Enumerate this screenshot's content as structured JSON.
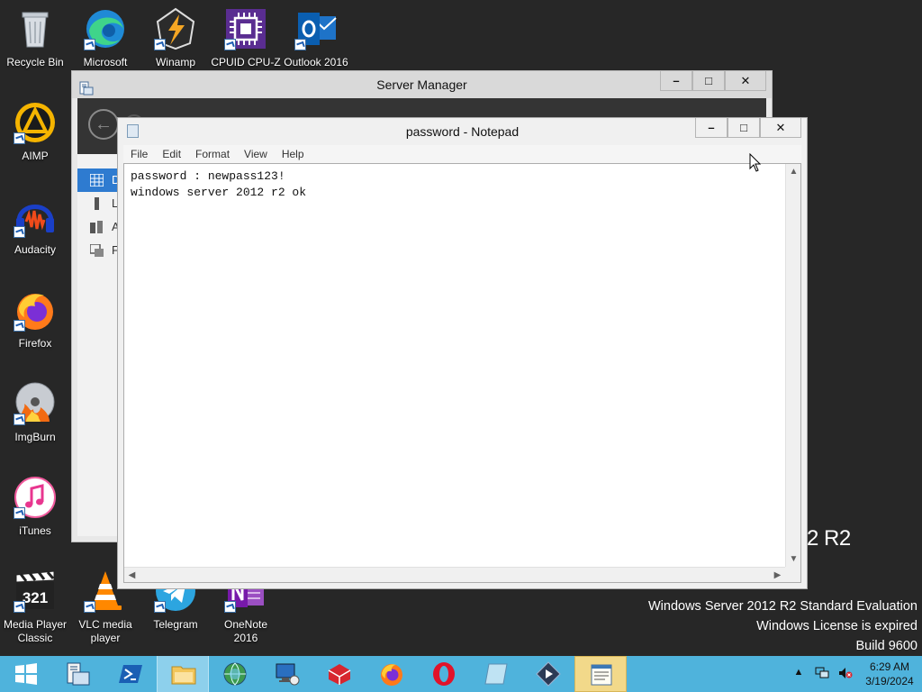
{
  "desktop": {
    "icons": [
      {
        "label": "Recycle Bin",
        "icon": "recycle-bin-icon"
      },
      {
        "label": "Microsoft Edge",
        "icon": "edge-icon"
      },
      {
        "label": "Winamp",
        "icon": "winamp-icon"
      },
      {
        "label": "CPUID CPU-Z",
        "icon": "cpuz-icon"
      },
      {
        "label": "Outlook 2016",
        "icon": "outlook-icon"
      },
      {
        "label": "AIMP",
        "icon": "aimp-icon"
      },
      {
        "label": "Audacity",
        "icon": "audacity-icon"
      },
      {
        "label": "Firefox",
        "icon": "firefox-icon"
      },
      {
        "label": "ImgBurn",
        "icon": "imgburn-icon"
      },
      {
        "label": "iTunes",
        "icon": "itunes-icon"
      },
      {
        "label": "Media Player Classic",
        "icon": "mpc-icon"
      },
      {
        "label": "VLC media player",
        "icon": "vlc-icon"
      },
      {
        "label": "Telegram",
        "icon": "telegram-icon"
      },
      {
        "label": "OneNote 2016",
        "icon": "onenote-icon"
      }
    ]
  },
  "watermark": {
    "edition_fragment": "2 R2",
    "line1": "Windows Server 2012 R2 Standard Evaluation",
    "line2": "Windows License is expired",
    "line3": "Build 9600"
  },
  "server_manager": {
    "title": "Server Manager",
    "nav_fragments": [
      "D",
      "L",
      "A",
      "F"
    ]
  },
  "notepad": {
    "title": "password - Notepad",
    "menu": [
      "File",
      "Edit",
      "Format",
      "View",
      "Help"
    ],
    "content": "password : newpass123!\nwindows server 2012 r2 ok"
  },
  "window_buttons": {
    "minimize": "–",
    "maximize": "□",
    "close": "✕"
  },
  "taskbar": {
    "apps": [
      {
        "name": "server-manager",
        "state": "normal"
      },
      {
        "name": "powershell",
        "state": "normal"
      },
      {
        "name": "file-explorer",
        "state": "active"
      },
      {
        "name": "network-globe",
        "state": "normal"
      },
      {
        "name": "remote-desktop",
        "state": "normal"
      },
      {
        "name": "red-app",
        "state": "normal"
      },
      {
        "name": "firefox",
        "state": "normal"
      },
      {
        "name": "opera",
        "state": "normal"
      },
      {
        "name": "notepad-blank",
        "state": "normal"
      },
      {
        "name": "media-player",
        "state": "normal"
      },
      {
        "name": "notepad",
        "state": "highlighted"
      }
    ],
    "clock": {
      "time": "6:29 AM",
      "date": "3/19/2024"
    }
  },
  "colors": {
    "desktop": "#272727",
    "taskbar": "#4fb3dc",
    "accent": "#2e7bd0"
  }
}
